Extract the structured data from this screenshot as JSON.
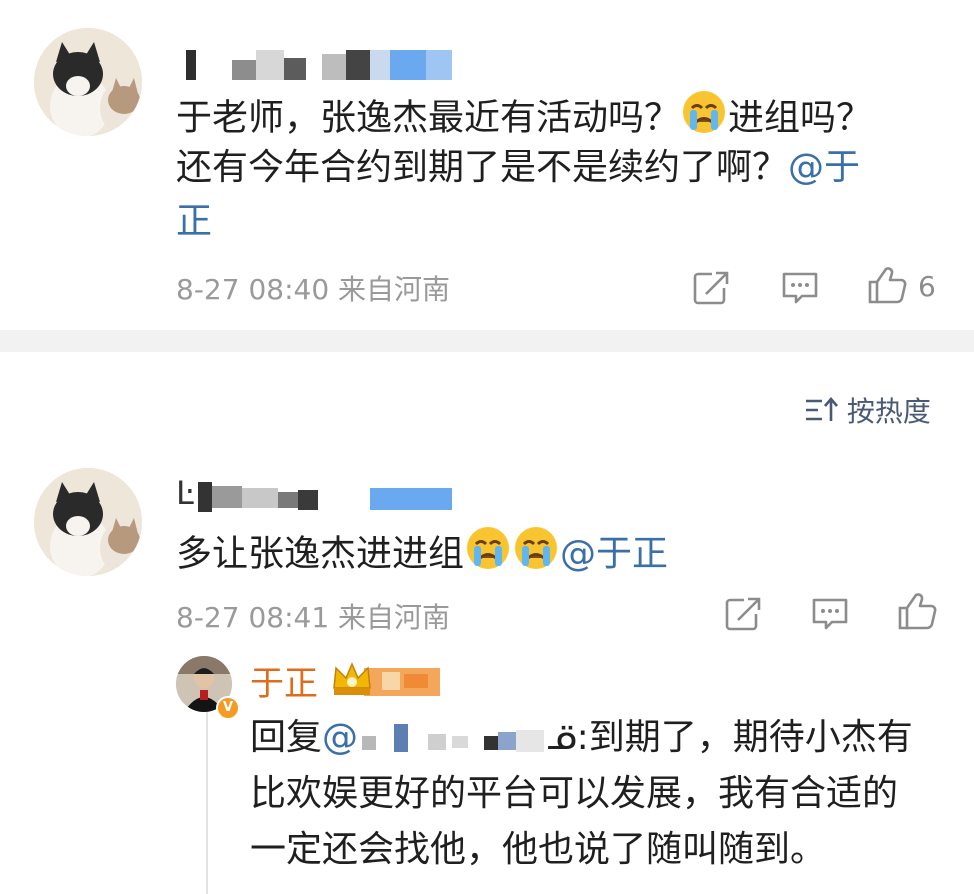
{
  "comment1": {
    "avatar_icon": "cat-avatar",
    "text_line1": "于老师，张逸杰最近有活动吗？",
    "emoji": "crying-face",
    "text_line1_tail": "进组吗？",
    "text_line2": "还有今年合约到期了是不是续约了啊？",
    "mention_line2": "@于",
    "mention_line3": "正",
    "time": "8-27 08:40",
    "location": "来自河南",
    "like_count": "6"
  },
  "sort": {
    "label": "按热度"
  },
  "comment2": {
    "avatar_icon": "cat-avatar",
    "name_fragment": "Ŀ",
    "text": "多让张逸杰进进组",
    "emoji_count": 2,
    "mention": "@于正",
    "time": "8-27 08:41",
    "location": "来自河南"
  },
  "reply": {
    "name": "于正",
    "badge_icon": "crown-badge-icon",
    "verified_icon": "verified-v-icon",
    "prefix": "回复",
    "at": "@",
    "suffix_after_blur": "ᓆ:到期了，期待小杰有",
    "line2": "比欢娱更好的平台可以发展，我有合适的",
    "line3": "一定还会找他，他也说了随叫随到。"
  },
  "colors": {
    "mention": "#3b6fa8",
    "reply_name": "#e06b1a",
    "meta": "#9a9a9a",
    "blur_blue": "#6aa8f0"
  }
}
